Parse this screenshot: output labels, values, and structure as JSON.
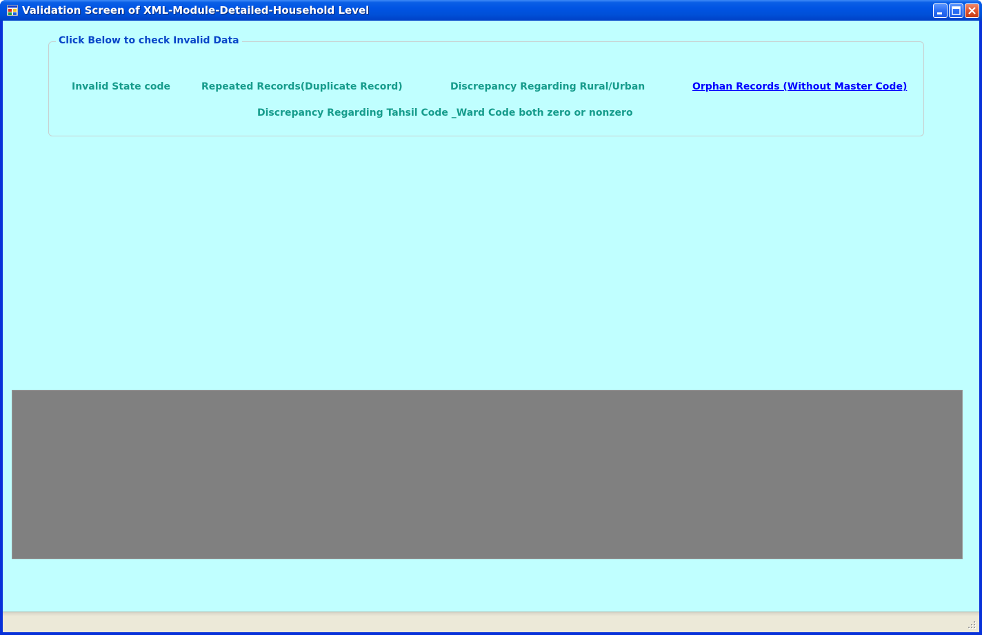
{
  "window": {
    "title": "Validation Screen of XML-Module-Detailed-Household Level"
  },
  "group": {
    "legend": "Click Below to check Invalid Data"
  },
  "links": {
    "invalid_state_code": "Invalid State code",
    "repeated_records": "Repeated Records(Duplicate Record)",
    "rural_urban": "Discrepancy Regarding Rural/Urban",
    "orphan_records": "Orphan Records (Without Master Code)",
    "tahsil_ward": "Discrepancy Regarding Tahsil Code _Ward Code both zero or nonzero"
  },
  "colors": {
    "client_background": "#c0ffff",
    "link_color": "#169c8c",
    "active_link_color": "#0000ff",
    "legend_color": "#0846c8",
    "grid_background": "#808080"
  }
}
